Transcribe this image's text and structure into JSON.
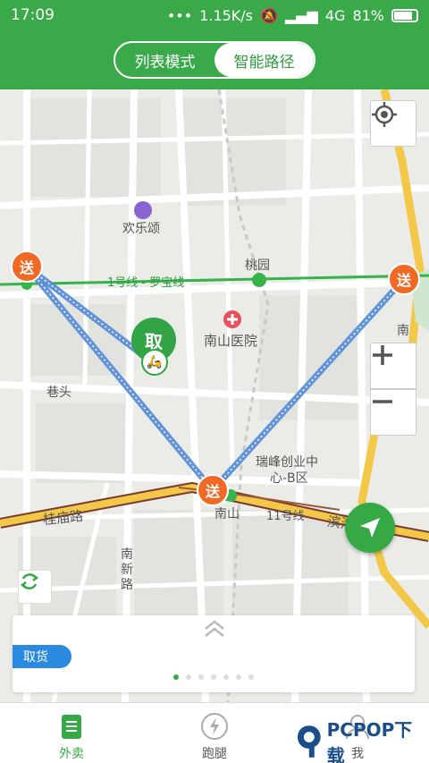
{
  "status": {
    "time": "17:09",
    "speed": "1.15K/s",
    "network": "4G",
    "battery": "81%"
  },
  "mode_switch": {
    "list_mode": "列表模式",
    "smart_route": "智能路径"
  },
  "map": {
    "labels": {
      "huanlesong": "欢乐颂",
      "taoyuan": "桃园",
      "line1": "1号线 - 罗宝线",
      "nanshan_hospital": "南山医院",
      "xiangtou": "巷头",
      "ruifeng": "瑞峰创业中",
      "ruifeng2": "心-B区",
      "nanshan": "南山",
      "line11": "11号线",
      "binhai": "滨海大道",
      "guimiao": "桂庙路",
      "nanxin": "南新路",
      "nan": "南"
    },
    "send_label": "送",
    "pick_label": "取"
  },
  "card": {
    "pickup_tag": "取货",
    "page_count": 7,
    "active_page": 0
  },
  "tabs": [
    {
      "label": "外卖",
      "active": true
    },
    {
      "label": "跑腿",
      "active": false
    },
    {
      "label": "我",
      "active": false
    }
  ],
  "watermark": {
    "text": "PCPOP下载"
  },
  "colors": {
    "brand_green": "#3aa94a",
    "send_orange": "#f06a25",
    "route_blue": "#5b8fd8",
    "metro_green": "#36b34a"
  }
}
